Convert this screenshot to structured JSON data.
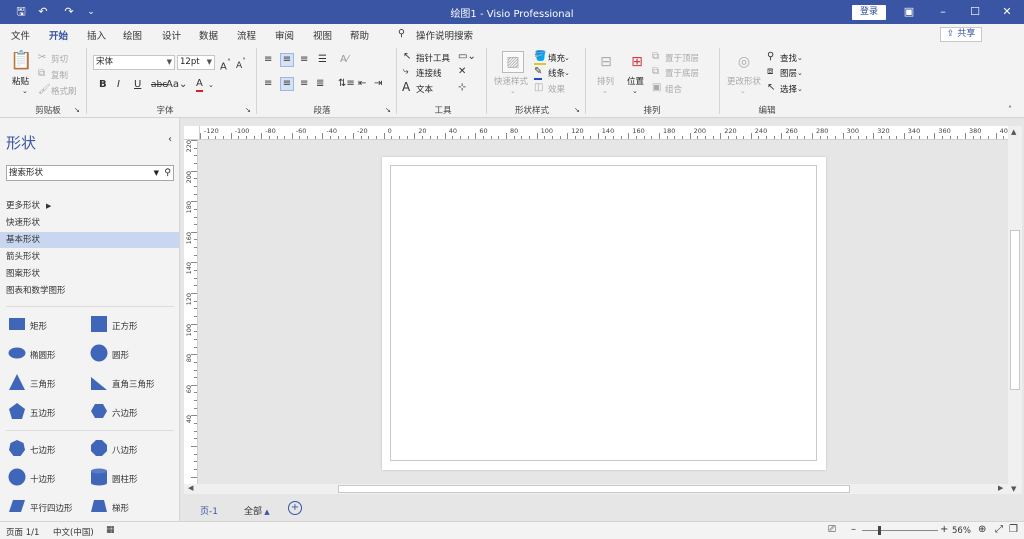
{
  "titlebar": {
    "title": "绘图1  -  Visio Professional",
    "login": "登录",
    "bg": "#3955a3"
  },
  "tabs": [
    "文件",
    "开始",
    "插入",
    "绘图",
    "设计",
    "数据",
    "流程",
    "审阅",
    "视图",
    "帮助"
  ],
  "active_tab": "开始",
  "tell_me": "操作说明搜索",
  "share": "共享",
  "ribbon": {
    "clipboard": {
      "paste": "粘贴",
      "cut": "剪切",
      "copy": "复制",
      "format_painter": "格式刷",
      "label": "剪贴板"
    },
    "font": {
      "name": "宋体",
      "size": "12pt",
      "label": "字体"
    },
    "paragraph": {
      "label": "段落"
    },
    "tools": {
      "pointer": "指针工具",
      "connector": "连接线",
      "text": "文本",
      "label": "工具"
    },
    "shape_styles": {
      "quick_styles": "快速样式",
      "fill": "填充",
      "line": "线条",
      "effects": "效果",
      "label": "形状样式"
    },
    "arrange": {
      "arrange": "排列",
      "position": "位置",
      "bring_front": "置于顶层",
      "send_back": "置于底层",
      "group": "组合",
      "label": "排列"
    },
    "editing": {
      "change_shape": "更改形状",
      "find": "查找",
      "layers": "图层",
      "select": "选择",
      "label": "编辑"
    }
  },
  "shapes_panel": {
    "title": "形状",
    "search_placeholder": "搜索形状",
    "more_shapes": "更多形状",
    "stencils": [
      "快速形状",
      "基本形状",
      "箭头形状",
      "图案形状",
      "图表和数学图形"
    ],
    "selected_stencil": "基本形状",
    "shapes": [
      "矩形",
      "正方形",
      "椭圆形",
      "圆形",
      "三角形",
      "直角三角形",
      "五边形",
      "六边形",
      "七边形",
      "八边形",
      "十边形",
      "圆柱形",
      "平行四边形",
      "梯形"
    ],
    "shape_color": "#3f66b8"
  },
  "ruler": {
    "h_ticks": [
      "-120",
      "-100",
      "-80",
      "-60",
      "-40",
      "-20",
      "0",
      "20",
      "40",
      "60",
      "80",
      "100",
      "120",
      "140",
      "160",
      "180",
      "200",
      "220",
      "240",
      "260",
      "280",
      "300",
      "320",
      "340",
      "360",
      "380",
      "400"
    ],
    "v_ticks": [
      "220",
      "200",
      "180",
      "160",
      "140",
      "120",
      "100",
      "80",
      "60",
      "40"
    ]
  },
  "page_tabs": {
    "page": "页-1",
    "all": "全部"
  },
  "status": {
    "page": "页面 1/1",
    "language": "中文(中国)",
    "zoom": "56%"
  }
}
